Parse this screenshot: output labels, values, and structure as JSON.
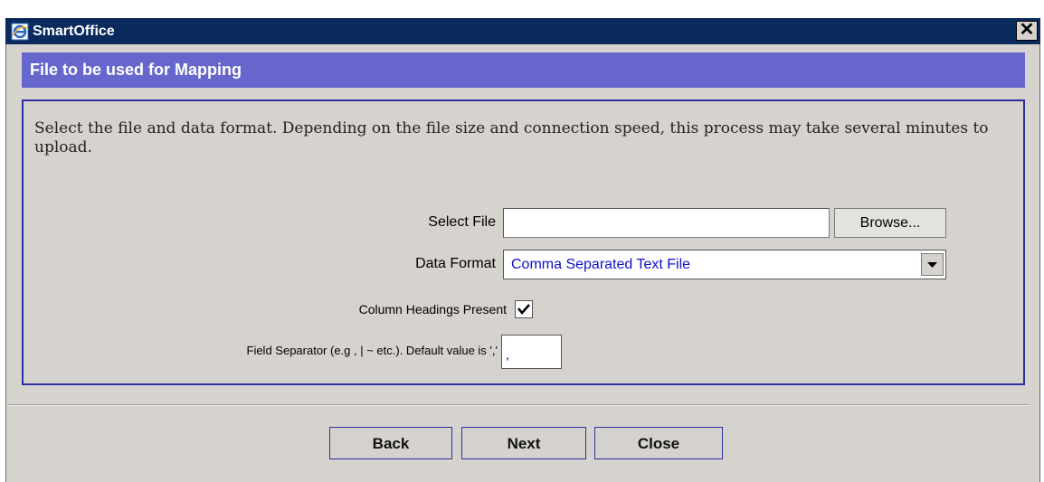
{
  "window": {
    "title": "SmartOffice",
    "close_label": "✕"
  },
  "header": {
    "title": "File to be used for Mapping"
  },
  "content": {
    "instructions": "Select the file and data format. Depending on the file size and connection speed, this process may take several minutes to upload.",
    "select_file_label": "Select File",
    "select_file_value": "",
    "browse_label": "Browse...",
    "data_format_label": "Data Format",
    "data_format_value": "Comma Separated Text File",
    "column_headings_label": "Column Headings Present",
    "column_headings_checked": true,
    "field_separator_label": "Field Separator (e.g , | ~ etc.). Default value is ','",
    "field_separator_value": ","
  },
  "footer": {
    "back_label": "Back",
    "next_label": "Next",
    "close_label": "Close"
  },
  "colors": {
    "titlebar": "#0a2a5e",
    "header": "#6666cc",
    "accent_border": "#2e2ea0",
    "select_text": "#1010c8"
  }
}
